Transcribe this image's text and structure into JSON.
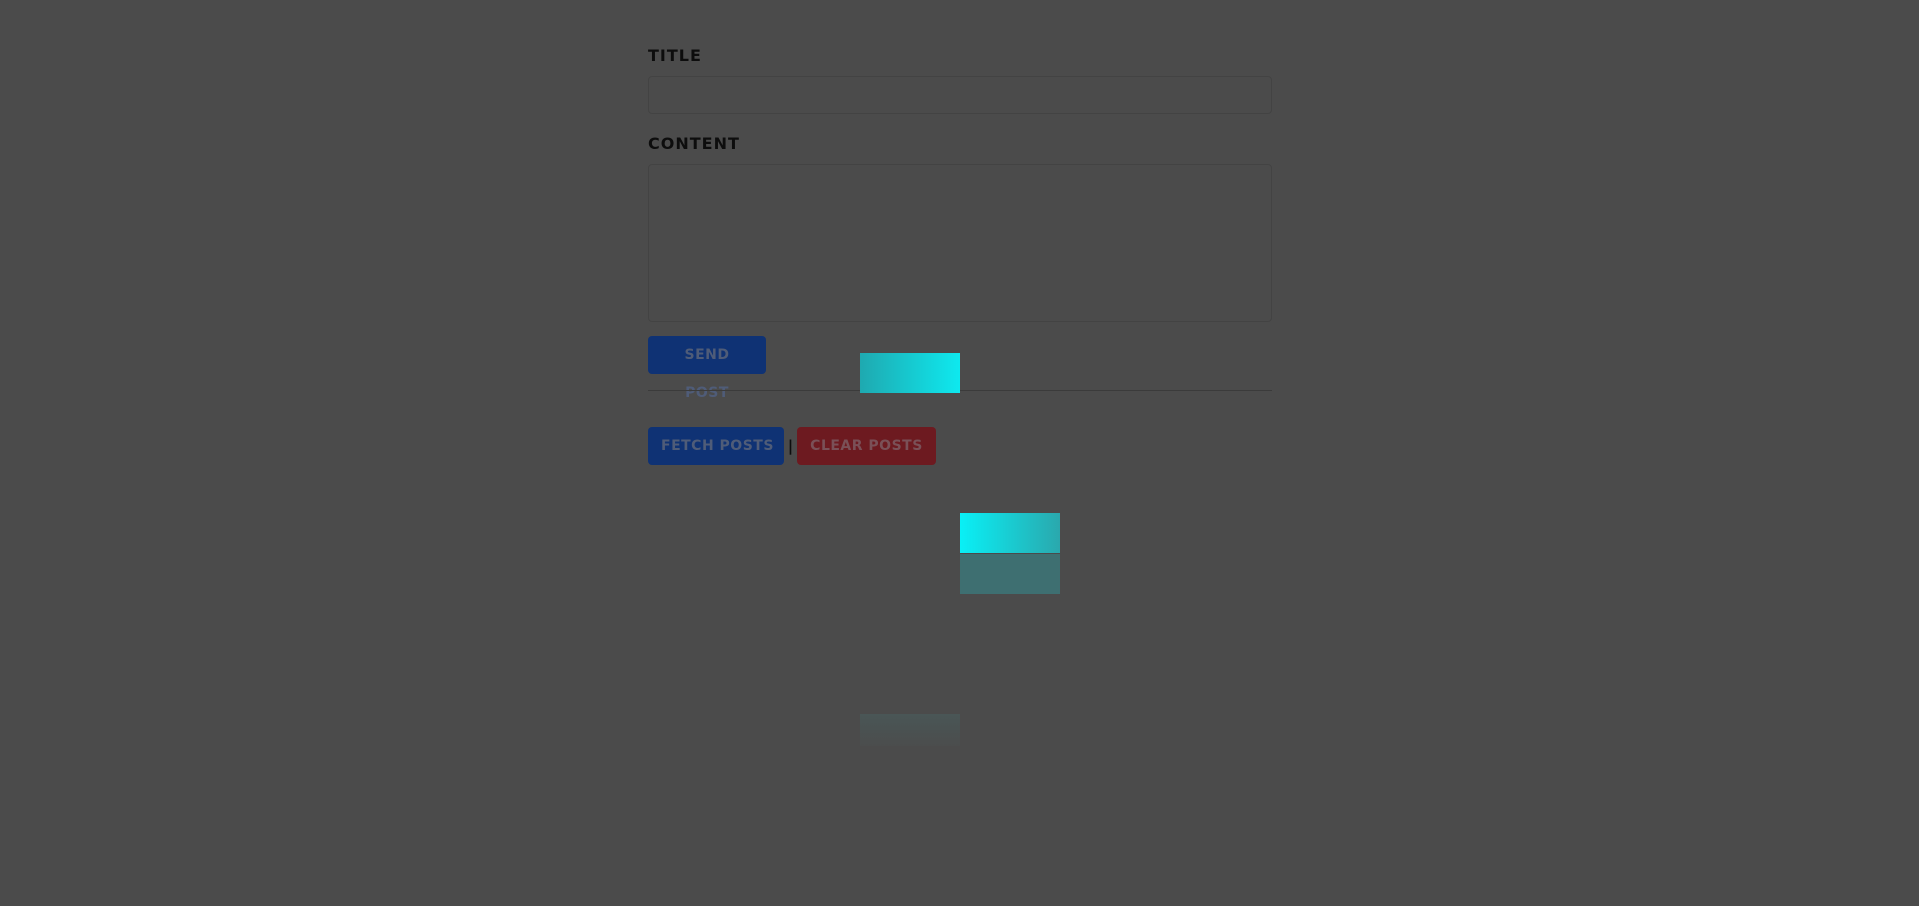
{
  "form": {
    "title_label": "Title",
    "title_value": "",
    "content_label": "Content",
    "content_value": "",
    "send_button": "Send post"
  },
  "actions": {
    "fetch_button": "Fetch posts",
    "separator": "|",
    "clear_button": "Clear posts"
  },
  "colors": {
    "background": "#4b4b4b",
    "primary_button": "#0f3274",
    "danger_button": "#6d1a20",
    "accent_cyan": "#0ee9ef"
  }
}
